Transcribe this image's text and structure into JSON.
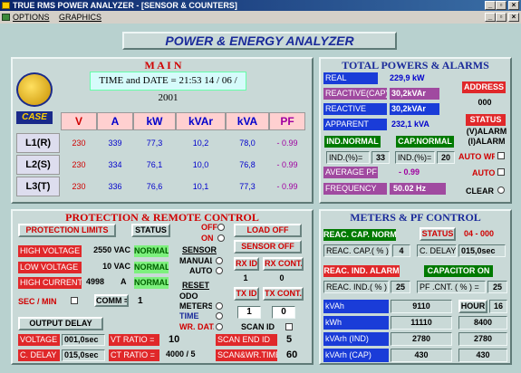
{
  "window": {
    "title": "TRUE RMS POWER ANALYZER - [SENSOR & COUNTERS]"
  },
  "menu": {
    "options": "OPTIONS",
    "graphics": "GRAPHICS"
  },
  "banner": "POWER & ENERGY  ANALYZER",
  "main": {
    "title": "M A I N",
    "datetime": "TIME and DATE = 21:53   14 / 06 / 2001",
    "logo": "CASE",
    "headers": [
      "V",
      "A",
      "kW",
      "kVAr",
      "kVA",
      "PF"
    ],
    "rows": [
      {
        "label": "L1(R)",
        "v": "230",
        "a": "339",
        "kw": "77,3",
        "kvar": "10,2",
        "kva": "78,0",
        "pf": "- 0.99"
      },
      {
        "label": "L2(S)",
        "v": "230",
        "a": "334",
        "kw": "76,1",
        "kvar": "10,0",
        "kva": "76,8",
        "pf": "- 0.99"
      },
      {
        "label": "L3(T)",
        "v": "230",
        "a": "336",
        "kw": "76,6",
        "kvar": "10,1",
        "kva": "77,3",
        "pf": "- 0.99"
      }
    ]
  },
  "totals": {
    "title": "TOTAL POWERS & ALARMS",
    "real_label": "REAL",
    "real_value": "229,9  kW",
    "reactive_cap_label": "REACTIVE(CAP)",
    "reactive_cap_value": "30,2kVAr",
    "reactive_label": "REACTIVE",
    "reactive_value": "30,2kVAr",
    "apparent_label": "APPARENT",
    "apparent_value": "232,1  kVA",
    "ind_normal": "IND.NORMAL",
    "cap_normal": "CAP.NORMAL",
    "ind_pct_label": "IND.(%)=",
    "ind_pct_value": "33",
    "ind_pct2_label": "IND.(%)=",
    "ind_pct2_value": "20",
    "avg_pf_label": "AVERAGE PF",
    "avg_pf_value": "- 0.99",
    "freq_label": "FREQUENCY",
    "freq_value": "50.02  Hz",
    "address_label": "ADDRESS",
    "address_value": "000",
    "status_label": "STATUS",
    "status_line1": "(V)ALARM",
    "status_line2": "(I)ALARM",
    "auto_wr": "AUTO WR",
    "auto": "AUTO",
    "clear": "CLEAR"
  },
  "protection": {
    "title": "PROTECTION  &  REMOTE CONTROL",
    "limits_label": "PROTECTION  LIMITS",
    "status_label": "STATUS",
    "hv_label": "HIGH VOLTAGE",
    "hv_value": "2550 VAC",
    "hv_status": "NORMAL",
    "lv_label": "LOW VOLTAGE",
    "lv_value": "10 VAC",
    "lv_status": "NORMAL",
    "hc_label": "HIGH CURRENT",
    "hc_value": "4998",
    "hc_unit": "A",
    "hc_status": "NORMAL",
    "sec_min": "SEC / MIN",
    "comm_label": "COMM =",
    "comm_value": "1",
    "output_delay": "OUTPUT DELAY",
    "voltage_label": "VOLTAGE",
    "voltage_value": "001,0sec",
    "cdelay_label": "C. DELAY",
    "cdelay_value": "015,0sec",
    "vt_label": "VT RATIO =",
    "vt_value": "10",
    "ct_label": "CT RATIO =",
    "ct_value": "4000 / 5",
    "off": "OFF",
    "on": "ON",
    "load_off": "LOAD OFF",
    "sensor_off": "SENSOR  OFF",
    "sensor": "SENSOR",
    "manual": "MANUAL",
    "auto": "AUTO",
    "rx_id": "RX ID",
    "rx_cont": "RX CONT.",
    "rx_id_value": "1",
    "rx_cont_value": "0",
    "reset": "RESET",
    "odo": "ODO",
    "meters": "METERS",
    "time": "TIME",
    "tx_id": "TX ID",
    "tx_cont": "TX CONT.",
    "tx_id_value": "1",
    "tx_cont_value": "0",
    "wr_data": "WR. DATA",
    "scan_id": "SCAN  ID",
    "scan_end_label": "SCAN  END  ID",
    "scan_end_value": "5",
    "scan_wr_label": "SCAN&WR.TIME",
    "scan_wr_value": "60"
  },
  "meters": {
    "title": "METERS & PF CONTROL",
    "reac_cap_normal": "REAC.  CAP. NORMAL",
    "status_label": "STATUS",
    "status_value": "04 - 000",
    "reac_cap_pct_label": "REAC. CAP.( % ) =",
    "reac_cap_pct_value": "4",
    "cdelay_label": "C. DELAY",
    "cdelay_value": "015,0sec",
    "reac_ind_alarm": "REAC.  IND.  ALARM",
    "capacitor_on": "CAPACITOR ON",
    "reac_ind_pct_label": "REAC. IND.( % ) =",
    "reac_ind_pct_value": "25",
    "pf_cnt_label": "PF .CNT.  ( % ) =",
    "pf_cnt_value": "25",
    "rows": [
      {
        "label": "kVAh",
        "value": "9110",
        "right_label": "HOUR",
        "right_value": "16"
      },
      {
        "label": "kWh",
        "value": "11110",
        "right_value": "8400"
      },
      {
        "label": "kVArh (IND)",
        "value": "2780",
        "right_value": "2780"
      },
      {
        "label": "kVArh (CAP)",
        "value": "430",
        "right_value": "430"
      }
    ]
  }
}
